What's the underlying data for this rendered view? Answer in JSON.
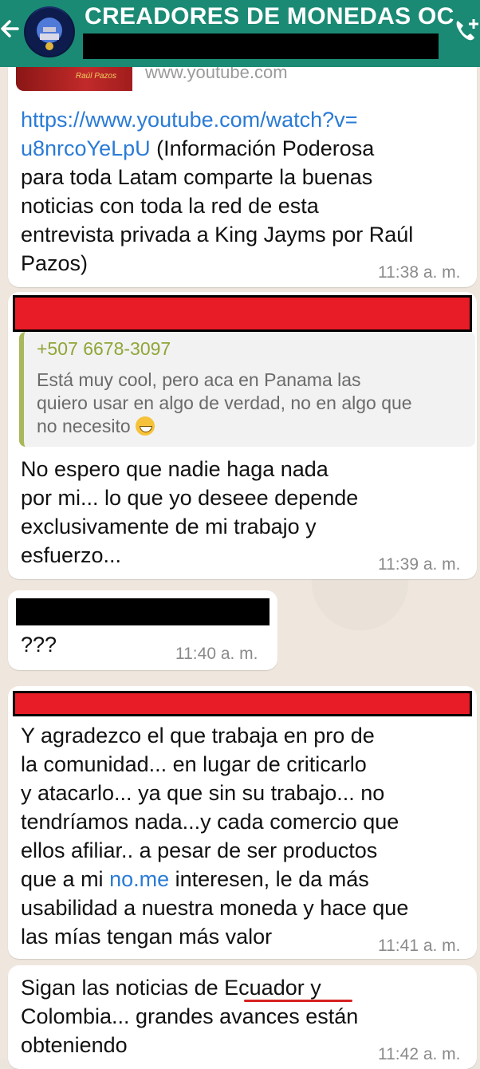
{
  "header": {
    "title": "CREADORES DE MONEDAS OC"
  },
  "messages": [
    {
      "preview_domain": "www.youtube.com",
      "preview_thumb_text": "Raúl Pazos",
      "link": "https://www.youtube.com/watch?v=\nu8nrcoYeLpU",
      "text": " (Información Poderosa\npara toda Latam comparte la buenas\nnoticias con toda la red de esta\nentrevista privada a King Jayms por Raúl\nPazos)",
      "time": "11:38 a. m."
    },
    {
      "quote_author": "+507 6678-3097",
      "quote_text": "Está muy cool, pero aca en Panama las\nquiero usar en algo de verdad, no en algo que\nno necesito",
      "text": "No espero que nadie haga nada\npor mi... lo que yo deseee depende\nexclusivamente de mi trabajo y\nesfuerzo...",
      "time": "11:39 a. m."
    },
    {
      "text": "???",
      "time": "11:40 a. m."
    },
    {
      "text_before_link": "Y agradezco el que trabaja en pro de\nla comunidad... en lugar de criticarlo\ny atacarlo... ya que sin su trabajo... no\ntendríamos nada...y cada comercio que\nellos afiliar..  a pesar de ser productos\nque a mi ",
      "inline_link": "no.me",
      "text_after_link": " interesen, le da más\nusabilidad a nuestra moneda y hace que\nlas mías tengan más valor",
      "time": "11:41 a. m."
    },
    {
      "text": "Sigan las noticias de Ecuador y\nColombia... grandes avances están\nobteniendo",
      "time": "11:42 a. m."
    }
  ],
  "colors": {
    "header": "#1a8a74",
    "bubble": "#ffffff",
    "link": "#2a7bd6",
    "quote_author": "#8fa637",
    "redaction_red": "#e81c26"
  },
  "icons": [
    "back-arrow-icon",
    "group-avatar",
    "add-call-icon",
    "grinning-emoji"
  ]
}
